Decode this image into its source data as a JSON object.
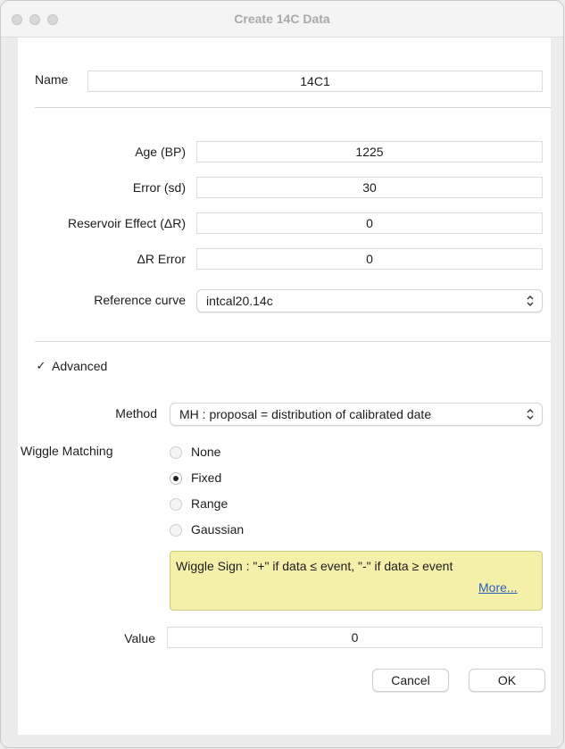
{
  "window": {
    "title": "Create 14C Data"
  },
  "name": {
    "label": "Name",
    "value": "14C1"
  },
  "age": {
    "label": "Age (BP)",
    "value": "1225"
  },
  "error": {
    "label": "Error (sd)",
    "value": "30"
  },
  "reservoir": {
    "label": "Reservoir Effect (ΔR)",
    "value": "0"
  },
  "dr_error": {
    "label": "ΔR Error",
    "value": "0"
  },
  "reference_curve": {
    "label": "Reference curve",
    "value": "intcal20.14c"
  },
  "advanced": {
    "label": "Advanced",
    "checked": true
  },
  "method": {
    "label": "Method",
    "value": "MH : proposal = distribution of calibrated date"
  },
  "wiggle": {
    "label": "Wiggle Matching",
    "options": [
      "None",
      "Fixed",
      "Range",
      "Gaussian"
    ],
    "selected": "Fixed"
  },
  "note": {
    "text": "Wiggle Sign : \"+\" if data ≤ event, \"-\" if data ≥ event",
    "link": "More..."
  },
  "value": {
    "label": "Value",
    "value": "0"
  },
  "buttons": {
    "cancel": "Cancel",
    "ok": "OK"
  },
  "icons": {
    "select_chevron": "chevron-updown-icon",
    "checkmark": "checkmark-icon"
  }
}
